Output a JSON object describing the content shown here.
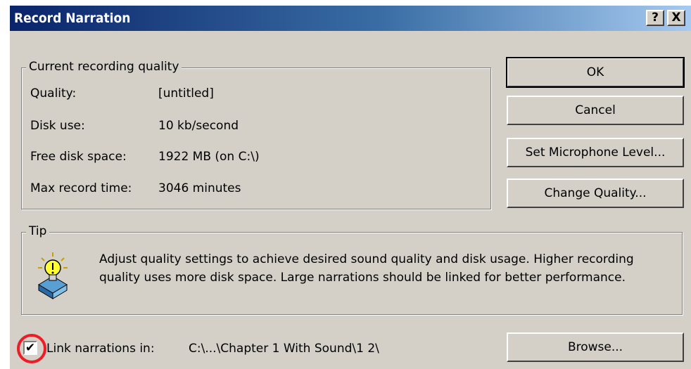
{
  "window": {
    "title": "Record Narration",
    "help_label": "?",
    "close_label": "X"
  },
  "quality_group": {
    "legend": "Current recording quality",
    "rows": [
      {
        "label": "Quality:",
        "value": "[untitled]"
      },
      {
        "label": "Disk use:",
        "value": "10 kb/second"
      },
      {
        "label": "Free disk space:",
        "value": "1922 MB (on C:\\)"
      },
      {
        "label": "Max record time:",
        "value": "3046 minutes"
      }
    ]
  },
  "buttons": {
    "ok": "OK",
    "cancel": "Cancel",
    "mic_level": "Set Microphone Level...",
    "change_quality": "Change Quality...",
    "browse": "Browse..."
  },
  "tip": {
    "legend": "Tip",
    "icon": "lightbulb-icon",
    "text": "Adjust quality settings to achieve desired sound quality and disk usage. Higher recording quality uses more disk space. Large narrations should be linked for better performance."
  },
  "link": {
    "checked": true,
    "check_mark": "✔",
    "label": "Link narrations in:",
    "path": "C:\\...\\Chapter 1 With Sound\\1 2\\"
  },
  "colors": {
    "dialog_bg": "#d4d0c8",
    "title_start": "#0a246a",
    "title_end": "#a6caf0",
    "highlight": "#ee1c25"
  }
}
